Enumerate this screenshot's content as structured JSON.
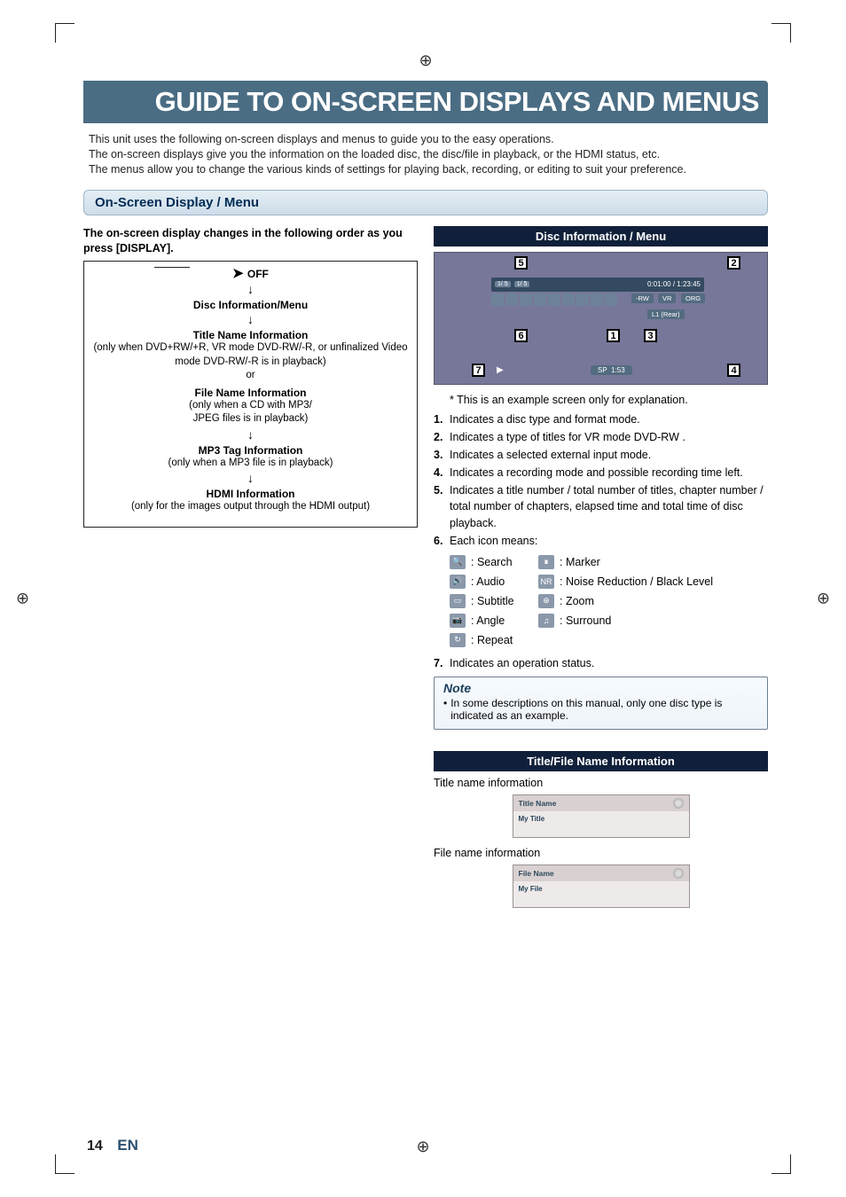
{
  "reg_mark_glyph": "⊕",
  "title": "GUIDE TO ON-SCREEN DISPLAYS AND MENUS",
  "intro_line1": "This unit uses the following on-screen displays and menus to guide you to the easy operations.",
  "intro_line2": "The on-screen displays give you the information on the loaded disc, the disc/file in playback, or the HDMI status, etc.",
  "intro_line3": "The menus allow you to change the various kinds of settings for playing back, recording, or editing to suit your preference.",
  "section_heading": "On-Screen Display / Menu",
  "left": {
    "lead": "The on-screen display changes in the following order as you press [DISPLAY].",
    "steps": {
      "off": "OFF",
      "disc_info": "Disc Information/Menu",
      "title_info": "Title Name Information",
      "title_note": "(only when DVD+RW/+R, VR mode DVD-RW/-R, or unfinalized Video mode DVD-RW/-R is in playback)",
      "or": "or",
      "file_info": "File Name Information",
      "file_note1": "(only when a CD with MP3/",
      "file_note2": "JPEG files is in playback)",
      "mp3_tag": "MP3 Tag Information",
      "mp3_note": "(only when a MP3 file is in playback)",
      "hdmi": "HDMI Information",
      "hdmi_note": "(only for the images output through the HDMI output)"
    }
  },
  "right_disc": {
    "header": "Disc Information / Menu",
    "osd": {
      "title_counter": "1/  5",
      "chapter_counter": "1/  5",
      "time": "0:01:00 / 1:23:45",
      "rw": "-RW",
      "vr": "VR",
      "org": "ORG",
      "input": "L1 (Rear)",
      "sp": "SP",
      "remain": "1:53"
    },
    "callouts": {
      "c1": "1",
      "c2": "2",
      "c3": "3",
      "c4": "4",
      "c5": "5",
      "c6": "6",
      "c7": "7"
    },
    "asterisk": "* This is an example screen only for explanation.",
    "items": {
      "i1": "Indicates a disc type and format mode.",
      "i2": "Indicates a type of titles for VR mode DVD-RW .",
      "i3": "Indicates a selected external input mode.",
      "i4": "Indicates a recording mode and possible recording time left.",
      "i5": "Indicates a title number / total number of titles, chapter number / total number of chapters, elapsed time and total time of disc playback.",
      "i6": "Each icon means:",
      "i7": "Indicates an operation status."
    },
    "icons": {
      "search": ": Search",
      "marker": ": Marker",
      "audio": ": Audio",
      "nr": ": Noise Reduction / Black Level",
      "subtitle": ": Subtitle",
      "zoom": ": Zoom",
      "angle": ": Angle",
      "surround": ": Surround",
      "repeat": ": Repeat",
      "nr_badge": "NR"
    },
    "note": {
      "title": "Note",
      "body": "In some descriptions on this manual, only one disc type is indicated as an example."
    }
  },
  "right_title": {
    "header": "Title/File Name Information",
    "title_caption": "Title name information",
    "title_box_hdr": "Title Name",
    "title_box_val": "My Title",
    "file_caption": "File name information",
    "file_box_hdr": "File Name",
    "file_box_val": "My File"
  },
  "footer": {
    "page": "14",
    "lang": "EN"
  }
}
